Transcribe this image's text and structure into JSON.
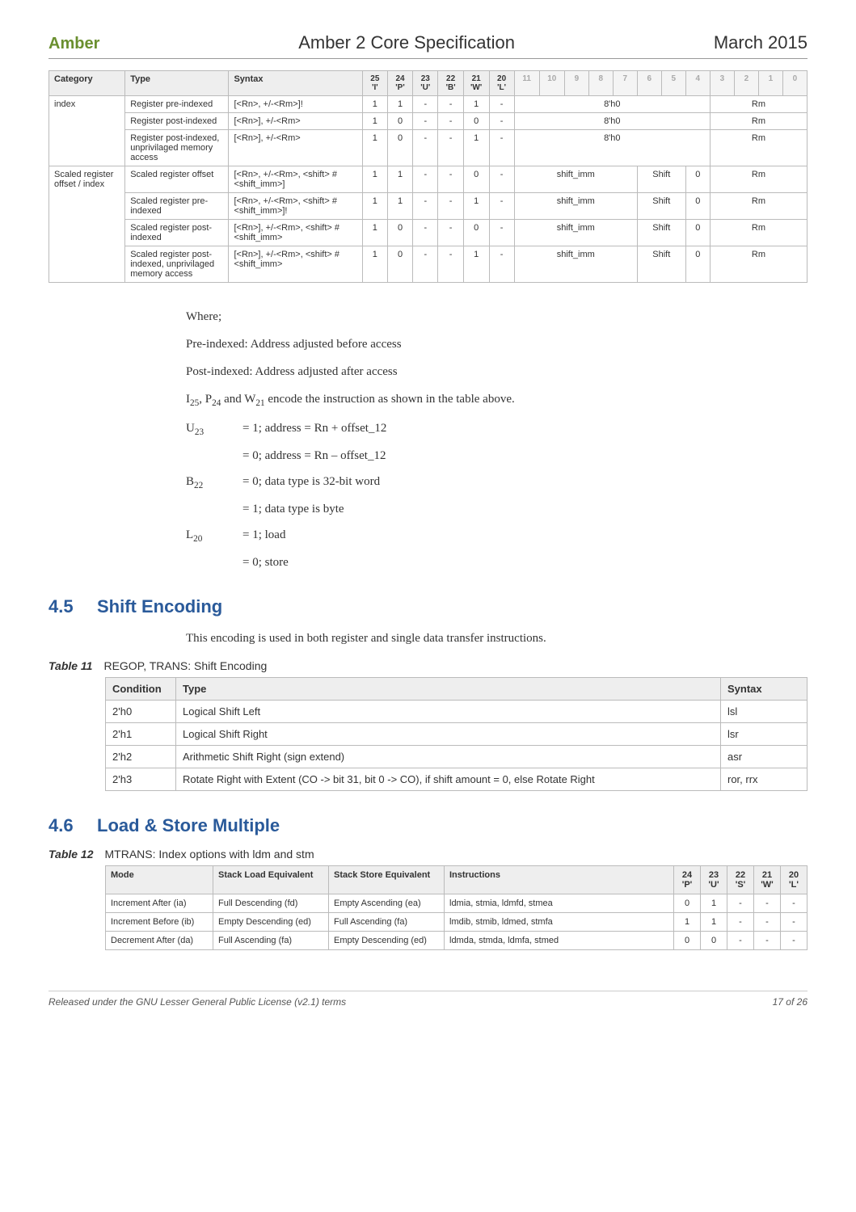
{
  "header": {
    "brand": "Amber",
    "title": "Amber 2 Core Specification",
    "date": "March 2015"
  },
  "table1": {
    "headers": {
      "category": "Category",
      "type": "Type",
      "syntax": "Syntax",
      "b25": "25\n'I'",
      "b24": "24\n'P'",
      "b23": "23\n'U'",
      "b22": "22\n'B'",
      "b21": "21\n'W'",
      "b20": "20\n'L'",
      "bits": [
        "11",
        "10",
        "9",
        "8",
        "7",
        "6",
        "5",
        "4",
        "3",
        "2",
        "1",
        "0"
      ]
    },
    "groups": [
      {
        "category": "index",
        "rows": [
          {
            "type": "Register pre-indexed",
            "syntax": "[<Rn>, +/-<Rm>]!",
            "b25": "1",
            "b24": "1",
            "b23": "-",
            "b22": "-",
            "b21": "1",
            "b20": "-",
            "upper": "8'h0",
            "lower": "Rm"
          },
          {
            "type": "Register post-indexed",
            "syntax": "[<Rn>], +/-<Rm>",
            "b25": "1",
            "b24": "0",
            "b23": "-",
            "b22": "-",
            "b21": "0",
            "b20": "-",
            "upper": "8'h0",
            "lower": "Rm"
          },
          {
            "type": "Register post-indexed, unprivilaged memory access",
            "syntax": "[<Rn>], +/-<Rm>",
            "b25": "1",
            "b24": "0",
            "b23": "-",
            "b22": "-",
            "b21": "1",
            "b20": "-",
            "upper": "8'h0",
            "lower": "Rm"
          }
        ]
      },
      {
        "category": "Scaled register offset / index",
        "rows": [
          {
            "type": "Scaled register offset",
            "syntax": "[<Rn>, +/-<Rm>, <shift> #<shift_imm>]",
            "b25": "1",
            "b24": "1",
            "b23": "-",
            "b22": "-",
            "b21": "0",
            "b20": "-",
            "f1": "shift_imm",
            "f2": "Shift",
            "f3": "0",
            "f4": "Rm"
          },
          {
            "type": "Scaled register pre-indexed",
            "syntax": "[<Rn>, +/-<Rm>, <shift> #<shift_imm>]!",
            "b25": "1",
            "b24": "1",
            "b23": "-",
            "b22": "-",
            "b21": "1",
            "b20": "-",
            "f1": "shift_imm",
            "f2": "Shift",
            "f3": "0",
            "f4": "Rm"
          },
          {
            "type": "Scaled register post-indexed",
            "syntax": "[<Rn>], +/-<Rm>, <shift> #<shift_imm>",
            "b25": "1",
            "b24": "0",
            "b23": "-",
            "b22": "-",
            "b21": "0",
            "b20": "-",
            "f1": "shift_imm",
            "f2": "Shift",
            "f3": "0",
            "f4": "Rm"
          },
          {
            "type": "Scaled register post-indexed, unprivilaged memory access",
            "syntax": "[<Rn>], +/-<Rm>, <shift> #<shift_imm>",
            "b25": "1",
            "b24": "0",
            "b23": "-",
            "b22": "-",
            "b21": "1",
            "b20": "-",
            "f1": "shift_imm",
            "f2": "Shift",
            "f3": "0",
            "f4": "Rm"
          }
        ]
      }
    ]
  },
  "body": {
    "where": "Where;",
    "pre": "Pre-indexed: Address adjusted before access",
    "post": "Post-indexed: Address adjusted after access",
    "encode_line_a": "I",
    "encode_line_a_sub": "25",
    "encode_line_b": ", P",
    "encode_line_b_sub": "24",
    "encode_line_c": " and W",
    "encode_line_c_sub": "21",
    "encode_line_d": " encode the instruction as shown in the table above.",
    "u23_label": "U",
    "u23_sub": "23",
    "u23_1": "= 1; address = Rn + offset_12",
    "u23_0": "= 0; address = Rn – offset_12",
    "b22_label": "B",
    "b22_sub": "22",
    "b22_0": "= 0; data type is 32-bit word",
    "b22_1": "= 1; data type is byte",
    "l20_label": "L",
    "l20_sub": "20",
    "l20_1": "= 1; load",
    "l20_0": "= 0; store"
  },
  "section45": {
    "num": "4.5",
    "title": "Shift Encoding",
    "intro": "This encoding is used in both register and single data transfer instructions."
  },
  "table11": {
    "caption_label": "Table 11",
    "caption": "REGOP, TRANS: Shift Encoding",
    "headers": {
      "cond": "Condition",
      "type": "Type",
      "syntax": "Syntax"
    },
    "rows": [
      {
        "cond": "2'h0",
        "type": "Logical Shift Left",
        "syntax": "lsl"
      },
      {
        "cond": "2'h1",
        "type": "Logical Shift Right",
        "syntax": "lsr"
      },
      {
        "cond": "2'h2",
        "type": "Arithmetic Shift Right (sign extend)",
        "syntax": "asr"
      },
      {
        "cond": "2'h3",
        "type": "Rotate Right with Extent (CO -> bit 31, bit 0 -> CO), if shift amount = 0, else Rotate Right",
        "syntax": "ror, rrx"
      }
    ]
  },
  "section46": {
    "num": "4.6",
    "title": "Load & Store Multiple"
  },
  "table12": {
    "caption_label": "Table 12",
    "caption": "MTRANS: Index options with ldm and stm",
    "headers": {
      "mode": "Mode",
      "load": "Stack Load Equivalent",
      "store": "Stack Store Equivalent",
      "instr": "Instructions",
      "b24": "24\n'P'",
      "b23": "23\n'U'",
      "b22": "22\n'S'",
      "b21": "21\n'W'",
      "b20": "20\n'L'"
    },
    "rows": [
      {
        "mode": "Increment After (ia)",
        "load": "Full Descending (fd)",
        "store": "Empty Ascending (ea)",
        "instr": "ldmia, stmia, ldmfd, stmea",
        "b24": "0",
        "b23": "1",
        "b22": "-",
        "b21": "-",
        "b20": "-"
      },
      {
        "mode": "Increment Before (ib)",
        "load": "Empty Descending (ed)",
        "store": "Full Ascending (fa)",
        "instr": "lmdib, stmib, ldmed, stmfa",
        "b24": "1",
        "b23": "1",
        "b22": "-",
        "b21": "-",
        "b20": "-"
      },
      {
        "mode": "Decrement After (da)",
        "load": "Full Ascending (fa)",
        "store": "Empty Descending (ed)",
        "instr": "ldmda, stmda, ldmfa, stmed",
        "b24": "0",
        "b23": "0",
        "b22": "-",
        "b21": "-",
        "b20": "-"
      }
    ]
  },
  "footer": {
    "left": "Released under the GNU Lesser General Public License (v2.1) terms",
    "right": "17 of 26"
  }
}
